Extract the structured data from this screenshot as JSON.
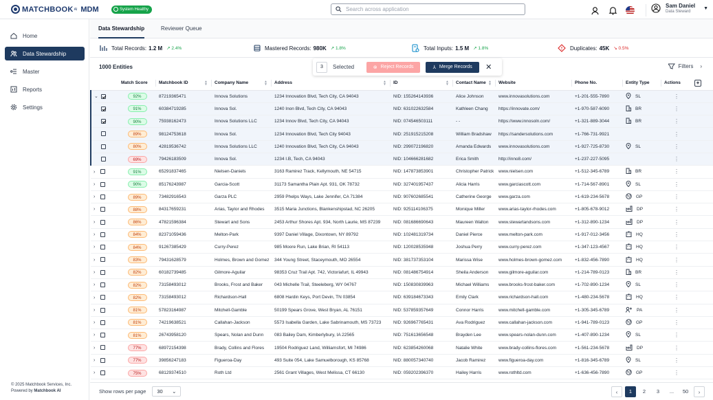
{
  "brand": {
    "name": "MATCHBOOK",
    "sup": "AI",
    "product": "MDM",
    "health": "System Healthy"
  },
  "search": {
    "placeholder": "Search across application"
  },
  "user": {
    "name": "Sam Daniel",
    "role": "Data Steward"
  },
  "sidebar": {
    "items": [
      {
        "label": "Home",
        "icon": "home-icon"
      },
      {
        "label": "Data Stewardship",
        "icon": "people-icon"
      },
      {
        "label": "Master",
        "icon": "master-icon"
      },
      {
        "label": "Reports",
        "icon": "reports-icon"
      },
      {
        "label": "Settings",
        "icon": "gear-icon"
      }
    ],
    "footer_line1": "© 2025 Matchbook Services, Inc.",
    "footer_line2": "Powered by",
    "footer_brand": "Matchbook AI"
  },
  "tabs": [
    "Data Stewardship",
    "Reviewer Queue"
  ],
  "stats": [
    {
      "label": "Total Records:",
      "value": "1.2 M",
      "trend": "2.4%",
      "dir": "up"
    },
    {
      "label": "Mastered Records:",
      "value": "980K",
      "trend": "1.8%",
      "dir": "up"
    },
    {
      "label": "Total Inputs:",
      "value": "1.5 M",
      "trend": "1.8%",
      "dir": "up"
    },
    {
      "label": "Duplicates:",
      "value": "45K",
      "trend": "0.5%",
      "dir": "down"
    }
  ],
  "toolbar": {
    "count": "1000 Entities",
    "selected_count": "3",
    "selected_label": "Selected",
    "reject_label": "Reject Records",
    "merge_label": "Merge Records",
    "filters_label": "Filters"
  },
  "columns": [
    "Match Score",
    "Matchbook ID",
    "Company Name",
    "Address",
    "ID",
    "Contact Name",
    "Website",
    "Phone No.",
    "Entity Type",
    "Actions"
  ],
  "rows": [
    {
      "exp": "v",
      "cb": "on",
      "child": true,
      "score": "92%",
      "sc": "g",
      "mid": "87219365471",
      "company": "Innova Solutions",
      "address": "1234 Innovation Blvd, Tech City, CA 94043",
      "id": "NID: 155264143936",
      "contact": "Alice Johnson",
      "website": "www.innovasolutions.com",
      "phone": "+1-201-555-7890",
      "et": "SL",
      "eti": "pin"
    },
    {
      "exp": "",
      "cb": "on",
      "child": true,
      "score": "91%",
      "sc": "g",
      "mid": "60384719285",
      "company": "Innova Sol.",
      "address": "1240 Inon Blvd, Tech City, CA 94043",
      "id": "NID: 631022632584",
      "contact": "Kathleen Chang",
      "website": "https://innovate.com/",
      "phone": "+1-970-587-6090",
      "et": "BR",
      "eti": "bld"
    },
    {
      "exp": "",
      "cb": "on",
      "child": true,
      "score": "90%",
      "sc": "g",
      "mid": "75938162473",
      "company": "Innova Solutions LLC",
      "address": "1234 Innov Blvd, Tech City, CA 94043",
      "id": "NID: 074546503111",
      "contact": "- -",
      "website": "https://www.innosoln.com/",
      "phone": "+1-321-889-3044",
      "et": "BR",
      "eti": "bld"
    },
    {
      "exp": "",
      "cb": "",
      "child": true,
      "score": "89%",
      "sc": "o",
      "mid": "98124753618",
      "company": "Innova Sol.",
      "address": "1234 Innovation Blvd, Tech City 94043",
      "id": "NID: 251915215208",
      "contact": "William Bradshaw",
      "website": "https://sandersolutions.com",
      "phone": "+1-766-731-9921",
      "et": "",
      "eti": ""
    },
    {
      "exp": "",
      "cb": "",
      "child": true,
      "score": "80%",
      "sc": "o",
      "mid": "42819536742",
      "company": "Innova Solutions LLC",
      "address": "1240 Innovation Blvd, Tech City, CA 94043",
      "id": "NID: 299072196820",
      "contact": "Amanda Edwards",
      "website": "www.innovasolutions.com",
      "phone": "+1-927-725-8730",
      "et": "SL",
      "eti": "pin"
    },
    {
      "exp": "",
      "cb": "",
      "child": true,
      "score": "69%",
      "sc": "r",
      "mid": "79426183509",
      "company": "Innova Sol.",
      "address": "1234 I.B, Tech, CA 94043",
      "id": "NID: 104666281682",
      "contact": "Erica Smith",
      "website": "http://inno8.com/",
      "phone": "+1-237-227-5095",
      "et": "",
      "eti": ""
    },
    {
      "exp": ">",
      "cb": "",
      "child": false,
      "score": "91%",
      "sc": "g",
      "mid": "65291837465",
      "company": "Nielsen-Daniels",
      "address": "3163 Ramirez Track, Kellymouth, NE 54715",
      "id": "NID: 147873853901",
      "contact": "Christopher Patrick",
      "website": "www.nielsen.com",
      "phone": "+1-512-345-6789",
      "et": "BR",
      "eti": "bld"
    },
    {
      "exp": ">",
      "cb": "",
      "child": false,
      "score": "90%",
      "sc": "g",
      "mid": "85176243987",
      "company": "Garcia-Scott",
      "address": "31173 Samantha Plain Apt. 931, OK 78732",
      "id": "NID: 327401957437",
      "contact": "Alicia Harris",
      "website": "www.garciascott.com",
      "phone": "+1-714-567-8901",
      "et": "SL",
      "eti": "pin"
    },
    {
      "exp": ">",
      "cb": "",
      "child": false,
      "score": "89%",
      "sc": "o",
      "mid": "73482916543",
      "company": "Garza PLC",
      "address": "2959 Phelps Ways, Lake Jennifer, CA 71384",
      "id": "NID: 907602685541",
      "contact": "Catherine George",
      "website": "www.garza.com",
      "phone": "+1-619-234-5678",
      "et": "GP",
      "eti": "glb"
    },
    {
      "exp": ">",
      "cb": "",
      "child": false,
      "score": "88%",
      "sc": "o",
      "mid": "84317659231",
      "company": "Arias, Taylor and Rhodes",
      "address": "3515 Maria Junctions, Blankenshipstad, NC 26205",
      "id": "NID: 925114106375",
      "contact": "Monique Miller",
      "website": "www.arias-taylor-rhodes.com",
      "phone": "+1-805-678-9012",
      "et": "DP",
      "eti": "fac"
    },
    {
      "exp": ">",
      "cb": "",
      "child": false,
      "score": "86%",
      "sc": "o",
      "mid": "47821596384",
      "company": "Stewart and Sons",
      "address": "2453 Arthur Shores Apt. 934, North Laurie, MS 87239",
      "id": "NID: 081686690643",
      "contact": "Maureen Walton",
      "website": "www.stewartandsons.com",
      "phone": "+1-312-890-1234",
      "et": "DP",
      "eti": "fac"
    },
    {
      "exp": ">",
      "cb": "",
      "child": false,
      "score": "84%",
      "sc": "o",
      "mid": "82371059436",
      "company": "Melton-Park",
      "address": "9397 Daniel Village, Dixontown, NY 89792",
      "id": "NID: 102481319734",
      "contact": "Daniel Pierce",
      "website": "www.melton-park.com",
      "phone": "+1-917-012-3456",
      "et": "HQ",
      "eti": "hq"
    },
    {
      "exp": ">",
      "cb": "",
      "child": false,
      "score": "84%",
      "sc": "o",
      "mid": "91267385429",
      "company": "Curry-Perez",
      "address": "985 Moore Run, Lake Brian, RI 54113",
      "id": "NID: 120028535948",
      "contact": "Joshua Perry",
      "website": "www.curry-perez.com",
      "phone": "+1-347-123-4567",
      "et": "HQ",
      "eti": "hq"
    },
    {
      "exp": ">",
      "cb": "",
      "child": false,
      "score": "83%",
      "sc": "o",
      "mid": "79431628579",
      "company": "Holmes, Brown and Gomez",
      "address": "344 Young Street, Staceymouth, MO 26554",
      "id": "NID: 381737353104",
      "contact": "Marissa Wise",
      "website": "www.holmes-brown-gomez.com",
      "phone": "+1-832-456-7890",
      "et": "HQ",
      "eti": "hq"
    },
    {
      "exp": ">",
      "cb": "",
      "child": false,
      "score": "82%",
      "sc": "o",
      "mid": "60182739485",
      "company": "Gilmore-Aguilar",
      "address": "98353 Cruz Trail Apt. 742, Victoriafurt, IL 49943",
      "id": "NID: 081486754914",
      "contact": "Sheila Anderson",
      "website": "www.gilmore-aguilar.com",
      "phone": "+1-214-789-0123",
      "et": "BR",
      "eti": "bld"
    },
    {
      "exp": ">",
      "cb": "",
      "child": false,
      "score": "82%",
      "sc": "o",
      "mid": "73158493012",
      "company": "Brooks, Frost and Baker",
      "address": "043 Michelle Trail, Steeleberg, WY 04767",
      "id": "NID: 150830839963",
      "contact": "Michael Williams",
      "website": "www.brooks-frost-baker.com",
      "phone": "+1-702-890-1234",
      "et": "SL",
      "eti": "pin"
    },
    {
      "exp": ">",
      "cb": "",
      "child": false,
      "score": "82%",
      "sc": "o",
      "mid": "73158493012",
      "company": "Richardson-Hall",
      "address": "6808 Hardin Keys, Port Devin, TN 03854",
      "id": "NID: 639184673343",
      "contact": "Emily Clark",
      "website": "www.richardson-hall.com",
      "phone": "+1-480-234-5678",
      "et": "HQ",
      "eti": "hq"
    },
    {
      "exp": ">",
      "cb": "",
      "child": false,
      "score": "81%",
      "sc": "o",
      "mid": "57823164987",
      "company": "Mitchell-Gamble",
      "address": "50199 Spears Grove, West Bryan, AL 76151",
      "id": "NID: 537859357649",
      "contact": "Connor Harris",
      "website": "www.mitchell-gamble.com",
      "phone": "+1-305-345-6789",
      "et": "PA",
      "eti": "pa"
    },
    {
      "exp": ">",
      "cb": "",
      "child": false,
      "score": "81%",
      "sc": "o",
      "mid": "74219638521",
      "company": "Callahan-Jackson",
      "address": "5573 Isabella Garden, Lake Sabrinamouth, MS 73723",
      "id": "NID: 926967765431",
      "contact": "Ava Rodriguez",
      "website": "www.callahan-jackson.com",
      "phone": "+1-941-789-0123",
      "et": "GP",
      "eti": "glb"
    },
    {
      "exp": ">",
      "cb": "",
      "child": false,
      "score": "81%",
      "sc": "o",
      "mid": "26743958120",
      "company": "Spears, Nolan and Dunn",
      "address": "083 Bailey Dam, Kimberlybury, IA 22565",
      "id": "NID: 751613656548",
      "contact": "Brayden Lee",
      "website": "www.spears-nolan-dunn.com",
      "phone": "+1-407-890-1234",
      "et": "SL",
      "eti": "pin"
    },
    {
      "exp": ">",
      "cb": "",
      "child": false,
      "score": "77%",
      "sc": "r",
      "mid": "68972154398",
      "company": "Brady, Collins and Flores",
      "address": "19504 Rodriguez Land, Williamsfort, MI 74986",
      "id": "NID: 623854260068",
      "contact": "Natalie White",
      "website": "www.brady-collins-flores.com",
      "phone": "+1-561-234-5678",
      "et": "DP",
      "eti": "fac"
    },
    {
      "exp": ">",
      "cb": "",
      "child": false,
      "score": "77%",
      "sc": "r",
      "mid": "39856247183",
      "company": "Figueroa-Day",
      "address": "493 Suite 054, Lake Samuelborough, KS 85768",
      "id": "NID: 880057340740",
      "contact": "Jacob Ramirez",
      "website": "www.figueroa-day.com",
      "phone": "+1-816-345-6789",
      "et": "SL",
      "eti": "pin"
    },
    {
      "exp": ">",
      "cb": "",
      "child": false,
      "score": "75%",
      "sc": "r",
      "mid": "68129374510",
      "company": "Roth Ltd",
      "address": "2561 Grant Villages, West Melissa, CT 66130",
      "id": "NID: 059202396370",
      "contact": "Hailey Harris",
      "website": "www.rothltd.com",
      "phone": "+1-636-456-7890",
      "et": "GP",
      "eti": "glb"
    }
  ],
  "pager": {
    "label": "Show rows per page",
    "rows_value": "30",
    "pages": [
      "1",
      "2",
      "3",
      "...",
      "50"
    ]
  }
}
